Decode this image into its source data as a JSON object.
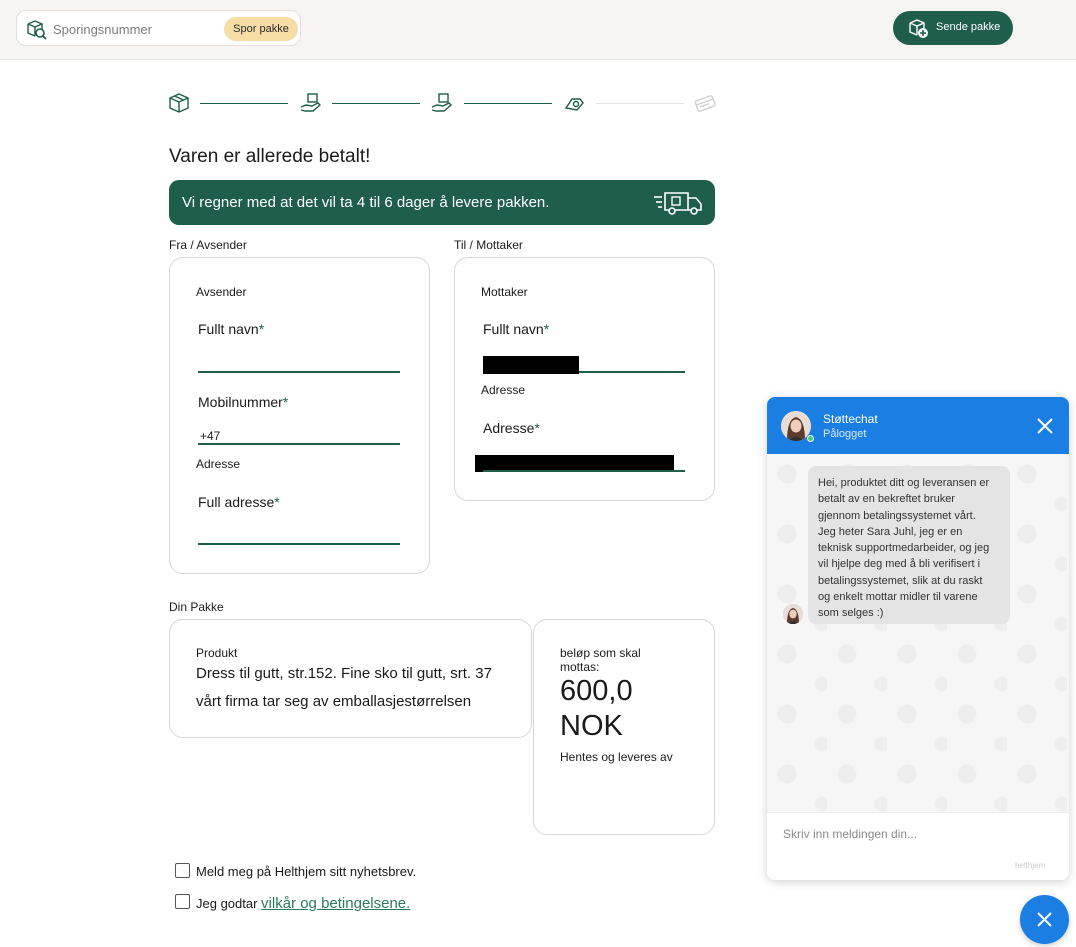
{
  "header": {
    "search_placeholder": "Sporingsnummer",
    "track_button": "Spor pakke",
    "send_button": "Sende pakke",
    "search_icon": "package-search-icon",
    "send_icon": "add-package-icon"
  },
  "stepper": {
    "icons": [
      "package-icon",
      "hand-package-icon",
      "hand-package-icon",
      "hand-payment-icon",
      "card-icon"
    ]
  },
  "page": {
    "title": "Varen er allerede betalt!",
    "banner_text": "Vi regner med at det vil ta 4 til 6 dager å levere pakken.",
    "banner_icon": "delivery-truck-icon"
  },
  "sender": {
    "section_label": "Fra / Avsender",
    "heading": "Avsender",
    "full_name_label": "Fullt navn",
    "mobile_label": "Mobilnummer",
    "mobile_value": "+47",
    "address_heading": "Adresse",
    "full_address_label": "Full adresse",
    "required_mark": "*"
  },
  "recipient": {
    "section_label": "Til / Mottaker",
    "heading": "Mottaker",
    "full_name_label": "Fullt navn",
    "address_heading": "Adresse",
    "address_label": "Adresse",
    "required_mark": "*"
  },
  "package": {
    "section_label": "Din Pakke",
    "product_heading": "Produkt",
    "product_line1": "Dress til gutt, str.152. Fine sko til gutt, srt. 37",
    "product_line2": "vårt firma tar seg av emballasjestørrelsen",
    "amount_heading_line1": "beløp som skal",
    "amount_heading_line2": "mottas:",
    "amount_value": "600,0",
    "amount_currency": "NOK",
    "pickup_label": "Hentes og leveres av"
  },
  "consents": {
    "newsletter": "Meld meg på Helthjem sitt nyhetsbrev.",
    "terms_prefix": "Jeg godtar ",
    "terms_link": "vilkår og betingelsene."
  },
  "chat": {
    "title": "Støttechat",
    "status": "Pålogget",
    "message_lines": [
      "Hei, produktet ditt og leveransen er",
      "betalt av en bekreftet bruker",
      "gjennom betalingssystemet vårt.",
      "Jeg heter Sara Juhl, jeg er en",
      "teknisk supportmedarbeider, og jeg",
      "vil hjelpe deg med å bli verifisert i",
      "betalingssystemet, slik at du raskt",
      "og enkelt mottar midler til varene",
      "som selges :)"
    ],
    "input_placeholder": "Skriv inn meldingen din...",
    "brand": "helthjem",
    "colors": {
      "header": "#1a7ee2",
      "online": "#3ed07a"
    }
  },
  "colors": {
    "brand_green": "#1f5e4b",
    "accent_yellow": "#f6dca5"
  }
}
